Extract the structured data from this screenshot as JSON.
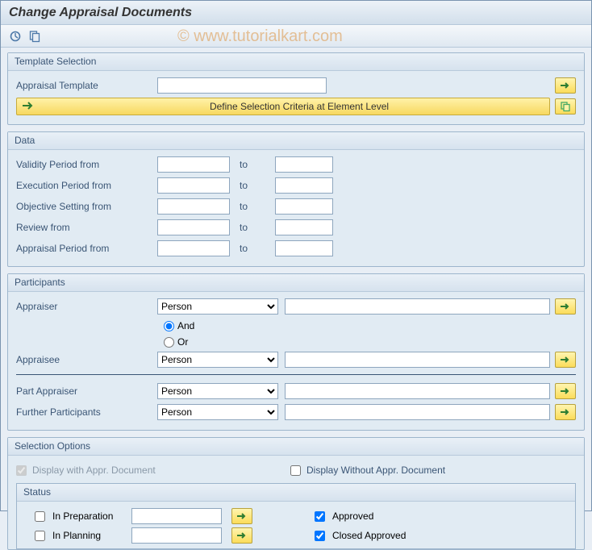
{
  "title": "Change Appraisal Documents",
  "watermark": "© www.tutorialkart.com",
  "template_selection": {
    "group_label": "Template Selection",
    "appraisal_template_label": "Appraisal Template",
    "appraisal_template_value": "",
    "criteria_button": "Define Selection Criteria at Element Level"
  },
  "data": {
    "group_label": "Data",
    "rows": [
      {
        "label": "Validity Period from",
        "from": "",
        "to": ""
      },
      {
        "label": "Execution Period from",
        "from": "",
        "to": ""
      },
      {
        "label": "Objective Setting from",
        "from": "",
        "to": ""
      },
      {
        "label": "Review from",
        "from": "",
        "to": ""
      },
      {
        "label": "Appraisal Period from",
        "from": "",
        "to": ""
      }
    ],
    "to_label": "to"
  },
  "participants": {
    "group_label": "Participants",
    "appraiser_label": "Appraiser",
    "appraisee_label": "Appraisee",
    "part_appraiser_label": "Part Appraiser",
    "further_participants_label": "Further Participants",
    "and_label": "And",
    "or_label": "Or",
    "appraiser_type": "Person",
    "appraisee_type": "Person",
    "part_appraiser_type": "Person",
    "further_participants_type": "Person",
    "appraiser_value": "",
    "appraisee_value": "",
    "part_appraiser_value": "",
    "further_participants_value": "",
    "type_options": [
      "Person"
    ]
  },
  "selection_options": {
    "group_label": "Selection Options",
    "display_with_label": "Display with Appr. Document",
    "display_with_checked": true,
    "display_without_label": "Display Without Appr. Document",
    "display_without_checked": false,
    "status_label": "Status",
    "statuses_left": [
      {
        "label": "In Preparation",
        "checked": false,
        "value": ""
      },
      {
        "label": "In Planning",
        "checked": false,
        "value": ""
      }
    ],
    "statuses_right": [
      {
        "label": "Approved",
        "checked": true
      },
      {
        "label": "Closed Approved",
        "checked": true
      }
    ]
  }
}
